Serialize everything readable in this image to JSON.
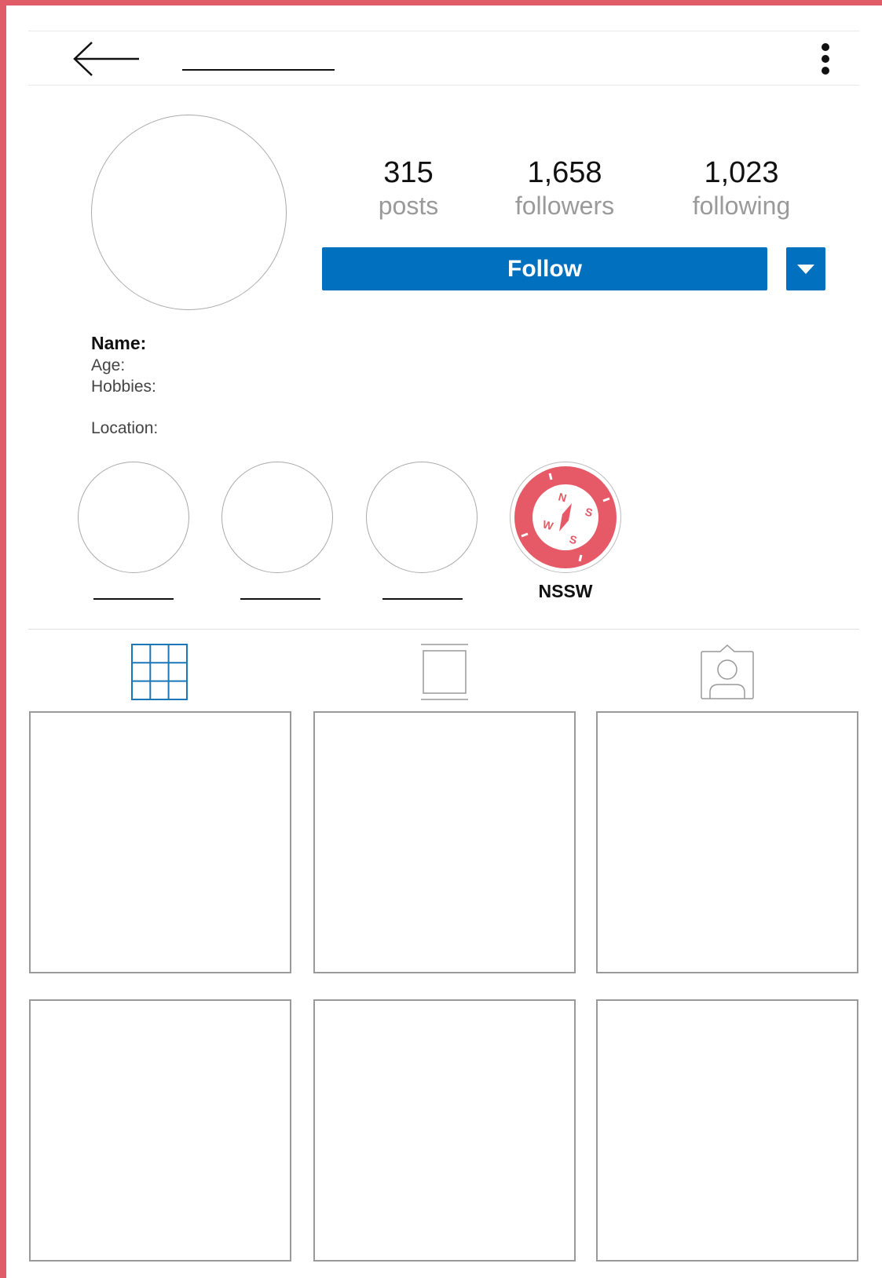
{
  "header": {
    "back_icon": "arrow-left-icon",
    "more_icon": "kebab-menu-icon"
  },
  "stats": [
    {
      "value": "315",
      "label": "posts"
    },
    {
      "value": "1,658",
      "label": "followers"
    },
    {
      "value": "1,023",
      "label": "following"
    }
  ],
  "actions": {
    "follow_label": "Follow",
    "dropdown_icon": "caret-down-icon",
    "accent": "#0070bf"
  },
  "bio": {
    "name": "Name:",
    "age": "Age:",
    "hobbies": "Hobbies:",
    "location": "Location:"
  },
  "highlights": [
    {
      "label": ""
    },
    {
      "label": ""
    },
    {
      "label": ""
    },
    {
      "label": "NSSW",
      "icon": "compass-icon",
      "color": "#e65a68"
    }
  ],
  "tabs": [
    {
      "icon": "grid-icon",
      "active": true
    },
    {
      "icon": "single-post-icon",
      "active": false
    },
    {
      "icon": "tagged-person-icon",
      "active": false
    }
  ],
  "posts": 6
}
